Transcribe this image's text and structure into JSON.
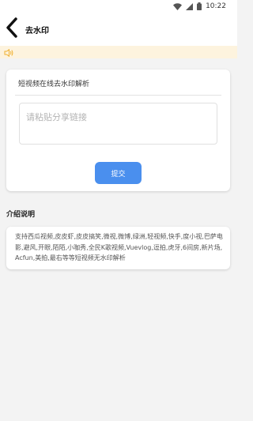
{
  "status_bar": {
    "time": "10:22"
  },
  "header": {
    "title": "去水印"
  },
  "parse_card": {
    "title": "短视频在线去水印解析",
    "input_placeholder": "请粘贴分享链接",
    "submit_label": "提交"
  },
  "intro": {
    "title": "介绍说明",
    "text": "支持西瓜视频,皮皮虾,皮皮搞笑,微视,微博,绿洲,轻视频,快手,度小视,巴萨电影,避风,开眼,陌陌,小咖秀,全民K歌视频,Vuevlog,逗拍,虎牙,6间房,新片场,Acfun,美拍,最右等等短视频无水印解析"
  },
  "colors": {
    "accent": "#4a8fee",
    "notice_bg": "#fdf3de",
    "notice_icon": "#f0b030"
  }
}
